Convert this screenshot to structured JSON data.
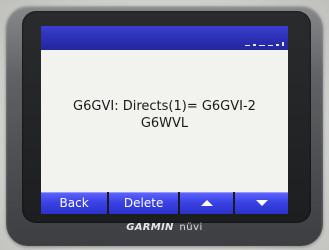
{
  "device": {
    "brand": "GARMIN",
    "model": "nüvi"
  },
  "screen": {
    "message_line1": "G6GVI: Directs(1)= G6GVI-2",
    "message_line2": "G6WVL"
  },
  "buttons": {
    "back_label": "Back",
    "delete_label": "Delete",
    "up_icon": "arrow-up-icon",
    "down_icon": "arrow-down-icon"
  },
  "colors": {
    "button_blue": "#3c43e6",
    "topbar_blue": "#2b2fb2",
    "screen_bg": "#f2f2ef"
  }
}
